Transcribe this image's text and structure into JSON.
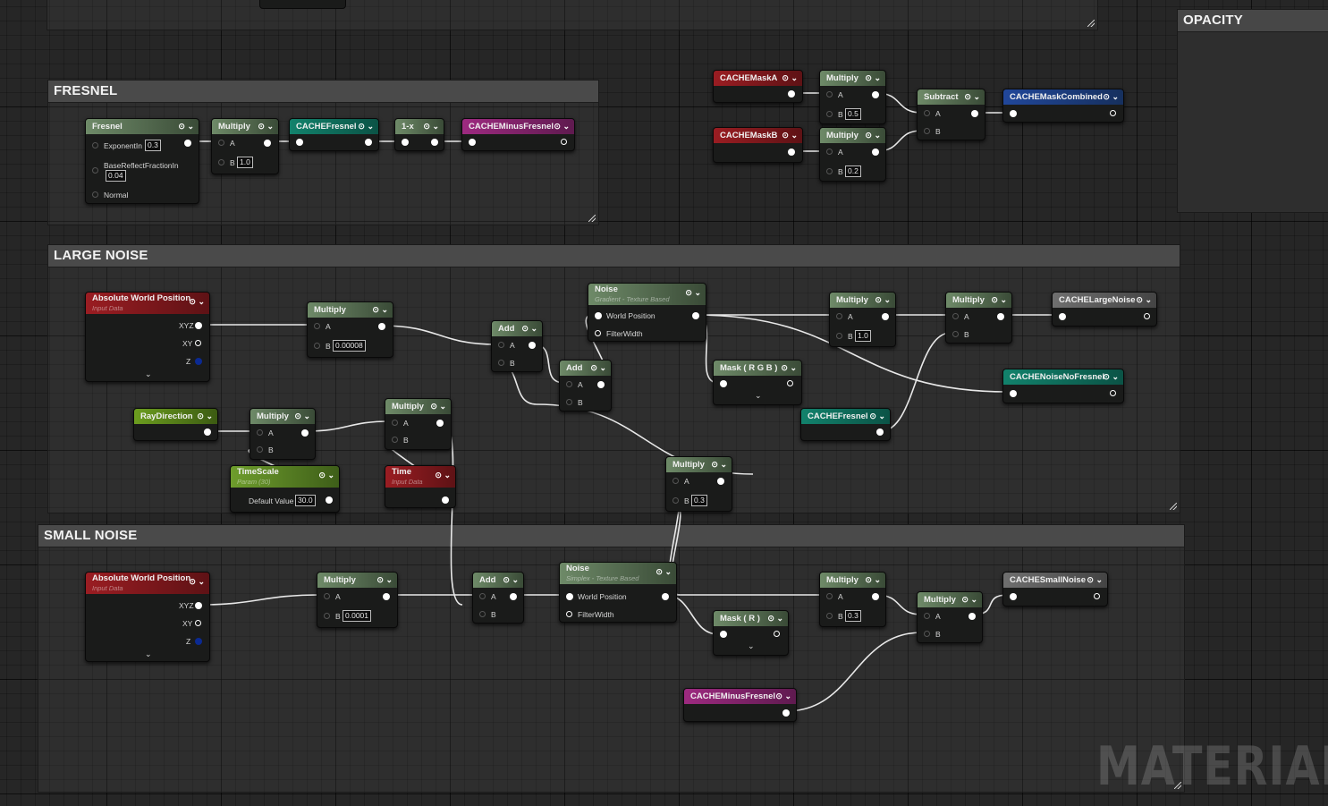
{
  "colors": {
    "wire": "#e8e8e8",
    "background": "#262626",
    "function": "#5f7a5a",
    "input": "#8c1b20",
    "cache": "#0e7563",
    "cache_minus": "#8a2471",
    "cache_combined": "#1f4590",
    "param": "#5d8c25",
    "cache_gray": "#5e5e5e"
  },
  "watermark": "MATERIAL",
  "opacity": {
    "title": "OPACITY"
  },
  "fresnel": {
    "title": "FRESNEL",
    "fresnel_node": {
      "title": "Fresnel",
      "exponent_label": "ExponentIn",
      "exponent_value": "0.3",
      "base_label": "BaseReflectFractionIn",
      "base_value": "0.04",
      "normal_label": "Normal"
    },
    "multiply": {
      "title": "Multiply",
      "a": "A",
      "b": "B",
      "b_value": "1.0"
    },
    "cache": {
      "title": "CACHEFresnel"
    },
    "oneminus": {
      "title": "1-x"
    },
    "minus": {
      "title": "CACHEMinusFresnel"
    }
  },
  "mask": {
    "mask_a": {
      "title": "CACHEMaskA"
    },
    "mask_b": {
      "title": "CACHEMaskB"
    },
    "mul_a": {
      "title": "Multiply",
      "a": "A",
      "b": "B",
      "b_value": "0.5"
    },
    "mul_b": {
      "title": "Multiply",
      "a": "A",
      "b": "B",
      "b_value": "0.2"
    },
    "subtract": {
      "title": "Subtract",
      "a": "A",
      "b": "B"
    },
    "combined": {
      "title": "CACHEMaskCombined"
    }
  },
  "large_noise": {
    "title": "LARGE NOISE",
    "awp": {
      "title": "Absolute World Position",
      "subtitle": "Input Data",
      "xyz": "XYZ",
      "xy": "XY",
      "z": "Z"
    },
    "mul1": {
      "title": "Multiply",
      "a": "A",
      "b": "B",
      "b_value": "0.00008"
    },
    "raydir": {
      "title": "RayDirection"
    },
    "mul2": {
      "title": "Multiply",
      "a": "A",
      "b": "B"
    },
    "timescale": {
      "title": "TimeScale",
      "subtitle": "Param (30)",
      "default_label": "Default Value",
      "default_value": "30.0"
    },
    "time": {
      "title": "Time",
      "subtitle": "Input Data"
    },
    "mul3": {
      "title": "Multiply",
      "a": "A",
      "b": "B"
    },
    "add1": {
      "title": "Add",
      "a": "A",
      "b": "B"
    },
    "add2": {
      "title": "Add",
      "a": "A",
      "b": "B"
    },
    "noise": {
      "title": "Noise",
      "subtitle": "Gradient - Texture Based",
      "world_position": "World Position",
      "filter_width": "FilterWidth"
    },
    "mask_rgb": {
      "title": "Mask ( R G B )"
    },
    "mul4": {
      "title": "Multiply",
      "a": "A",
      "b": "B",
      "b_value": "0.3"
    },
    "mul5": {
      "title": "Multiply",
      "a": "A",
      "b": "B",
      "b_value": "1.0"
    },
    "mul6": {
      "title": "Multiply",
      "a": "A",
      "b": "B"
    },
    "cache_fresnel": {
      "title": "CACHEFresnel"
    },
    "cache_large": {
      "title": "CACHELargeNoise"
    },
    "cache_nofresnel": {
      "title": "CACHENoiseNoFresnel"
    }
  },
  "small_noise": {
    "title": "SMALL NOISE",
    "awp": {
      "title": "Absolute World Position",
      "subtitle": "Input Data",
      "xyz": "XYZ",
      "xy": "XY",
      "z": "Z"
    },
    "mul1": {
      "title": "Multiply",
      "a": "A",
      "b": "B",
      "b_value": "0.0001"
    },
    "add": {
      "title": "Add",
      "a": "A",
      "b": "B"
    },
    "noise": {
      "title": "Noise",
      "subtitle": "Simplex - Texture Based",
      "world_position": "World Position",
      "filter_width": "FilterWidth"
    },
    "mask_r": {
      "title": "Mask ( R )"
    },
    "mul2": {
      "title": "Multiply",
      "a": "A",
      "b": "B",
      "b_value": "0.3"
    },
    "mul3": {
      "title": "Multiply",
      "a": "A",
      "b": "B"
    },
    "cache_small": {
      "title": "CACHESmallNoise"
    },
    "cache_minus": {
      "title": "CACHEMinusFresnel"
    }
  }
}
